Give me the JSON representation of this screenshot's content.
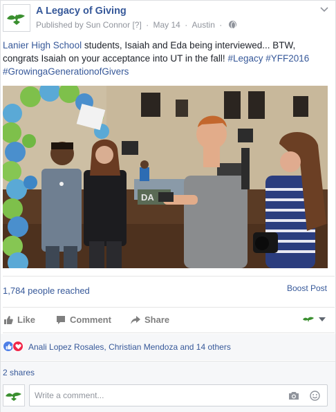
{
  "post": {
    "page_name": "A Legacy of Giving",
    "publisher_prefix": "Published by",
    "publisher": "Sun Connor",
    "help_marker": "[?]",
    "date": "May 14",
    "location": "Austin",
    "text": {
      "link_school": "Lanier High School",
      "body_1": " students, Isaiah and Eda being interviewed... BTW, congrats Isaiah on your acceptance into UT in the fall! ",
      "hashtag_1": "#Legacy",
      "hashtag_2": "#YFF2016",
      "hashtag_3": "#GrowingaGenerationofGivers"
    },
    "photo_sign": "DA"
  },
  "stats": {
    "reach": "1,784 people reached",
    "boost": "Boost Post"
  },
  "actions": {
    "like": "Like",
    "comment": "Comment",
    "share": "Share"
  },
  "reactions": {
    "names": "Anali Lopez Rosales, Christian Mendoza and 14 others"
  },
  "shares": "2 shares",
  "comment": {
    "placeholder": "Write a comment..."
  },
  "colors": {
    "link": "#365899",
    "brand_green": "#3a8f2f",
    "like_blue": "#4e7fe6",
    "love_red": "#f0284a"
  }
}
